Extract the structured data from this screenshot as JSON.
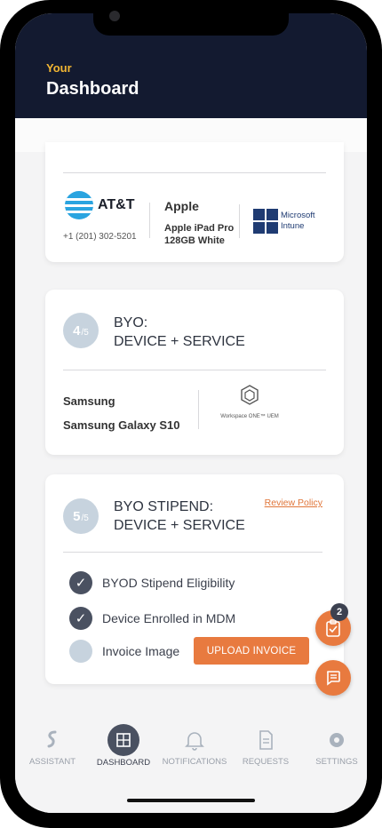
{
  "header": {
    "eyebrow": "Your",
    "title": "Dashboard"
  },
  "card1": {
    "carrier": "AT&T",
    "phone": "+1 (201) 302-5201",
    "device_brand": "Apple",
    "device_model": "Apple iPad Pro 128GB White",
    "mdm": "Microsoft Intune"
  },
  "card2": {
    "step": "4",
    "step_total": "/5",
    "title_line1": "BYO:",
    "title_line2": "DEVICE + SERVICE",
    "device_brand": "Samsung",
    "device_model": "Samsung Galaxy S10",
    "mdm": "Workspace ONE™ UEM"
  },
  "card3": {
    "step": "5",
    "step_total": "/5",
    "title_line1": "BYO STIPEND:",
    "title_line2": "DEVICE + SERVICE",
    "review_link": "Review Policy",
    "checklist": [
      {
        "label": "BYOD Stipend Eligibility",
        "done": true
      },
      {
        "label": "Device Enrolled in MDM",
        "done": true
      },
      {
        "label": "Invoice Image",
        "done": false
      }
    ],
    "upload_label": "UPLOAD INVOICE"
  },
  "fab": {
    "tasks_count": "2"
  },
  "nav": [
    {
      "label": "ASSISTANT",
      "icon": "assistant-icon"
    },
    {
      "label": "DASHBOARD",
      "icon": "dashboard-icon",
      "active": true
    },
    {
      "label": "NOTIFICATIONS",
      "icon": "bell-icon"
    },
    {
      "label": "REQUESTS",
      "icon": "document-icon"
    },
    {
      "label": "SETTINGS",
      "icon": "gear-icon"
    }
  ],
  "colors": {
    "accent": "#e87a3f",
    "header_bg": "#131a30",
    "eyebrow": "#f2b632",
    "dark": "#4a5161"
  }
}
